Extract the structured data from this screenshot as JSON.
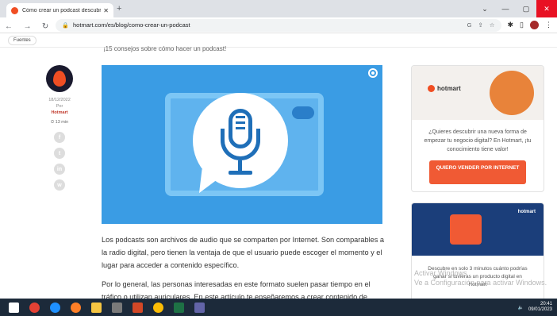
{
  "browser": {
    "tab_title": "Cómo crear un podcast descubr",
    "url": "hotmart.com/es/blog/como-crear-un-podcast",
    "bookmark": "Fuentes"
  },
  "article": {
    "intro": "¡15 consejos sobre cómo hacer un podcast!",
    "date": "18/12/2022",
    "by": "Por",
    "author": "Hotmart",
    "read_time": "13 min",
    "para1": "Los podcasts son archivos de audio que se comparten por Internet. Son comparables a la radio digital, pero tienen la ventaja de que el usuario puede escoger el momento y el lugar para acceder a contenido específico.",
    "para2": "Por lo general, las personas interesadas en este formato suelen pasar tiempo en el tráfico o utilizan auriculares. En este artículo te enseñaremos a crear contenido de"
  },
  "social": [
    "f",
    "t",
    "in",
    "w"
  ],
  "ad1": {
    "brand": "hotmart",
    "text": "¿Quieres descubrir una nueva forma de empezar tu negocio digital? En Hotmart, ¡tu conocimiento tiene valor!",
    "cta": "QUIERO VENDER POR INTERNET"
  },
  "ad2": {
    "brand": "hotmart",
    "text": "Descubre en solo 3 minutos cuánto podrías ganar si tuvieras un producto digital en Hotmart"
  },
  "watermark": {
    "line1": "Activar Windows",
    "line2": "Ve a Configuración para activar Windows."
  },
  "taskbar": {
    "time": "20:41",
    "date": "09/01/2023"
  }
}
